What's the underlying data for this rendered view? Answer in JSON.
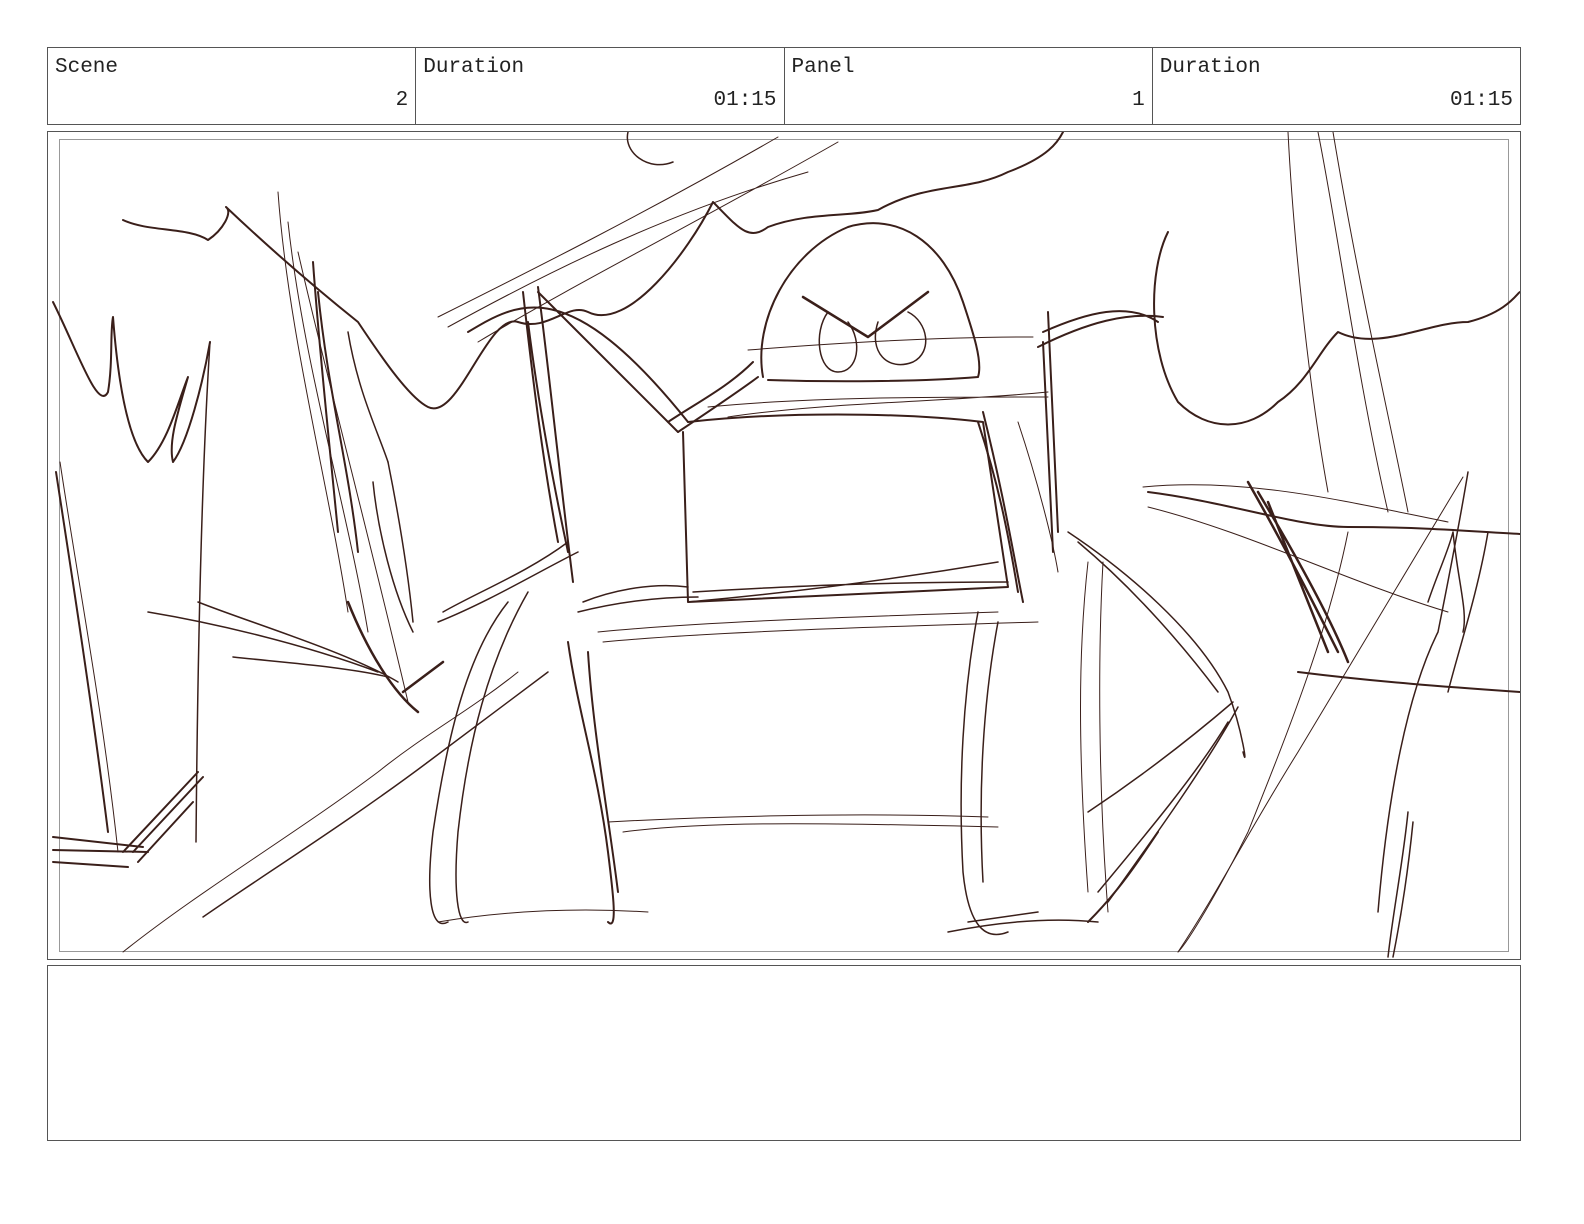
{
  "header": {
    "scene_label": "Scene",
    "scene_value": "2",
    "scene_duration_label": "Duration",
    "scene_duration_value": "01:15",
    "panel_label": "Panel",
    "panel_value": "1",
    "panel_duration_label": "Duration",
    "panel_duration_value": "01:15"
  },
  "sketch": {
    "stroke_color": "#3a1f1a"
  },
  "notes": {
    "text": ""
  }
}
